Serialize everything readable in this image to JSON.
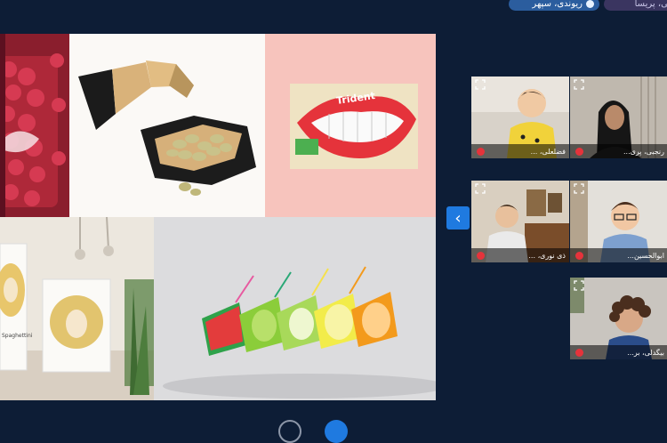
{
  "top_bar": {
    "tags": [
      {
        "label": "ریوندی، سپهر"
      },
      {
        "label": "ییمی، پریسا"
      }
    ]
  },
  "shared_screen": {
    "tiles": [
      {
        "name": "raspberry-package",
        "text": ""
      },
      {
        "name": "pistachio-package",
        "text": ""
      },
      {
        "name": "trident-gum-package",
        "text": "Trident"
      },
      {
        "name": "spaghetti-hair-package",
        "text": "Spaghettini"
      },
      {
        "name": "fruit-juice-boxes",
        "text": ""
      }
    ]
  },
  "participants": [
    {
      "name": "فضلعلی، ..."
    },
    {
      "name": "رنجبی، پری..."
    },
    {
      "name": "ذی نوری، ..."
    },
    {
      "name": "ابوالحسین..."
    },
    {
      "name": "بیگدلی، بر..."
    }
  ],
  "controls": {
    "collapse_icon": "chevron-left-icon"
  }
}
